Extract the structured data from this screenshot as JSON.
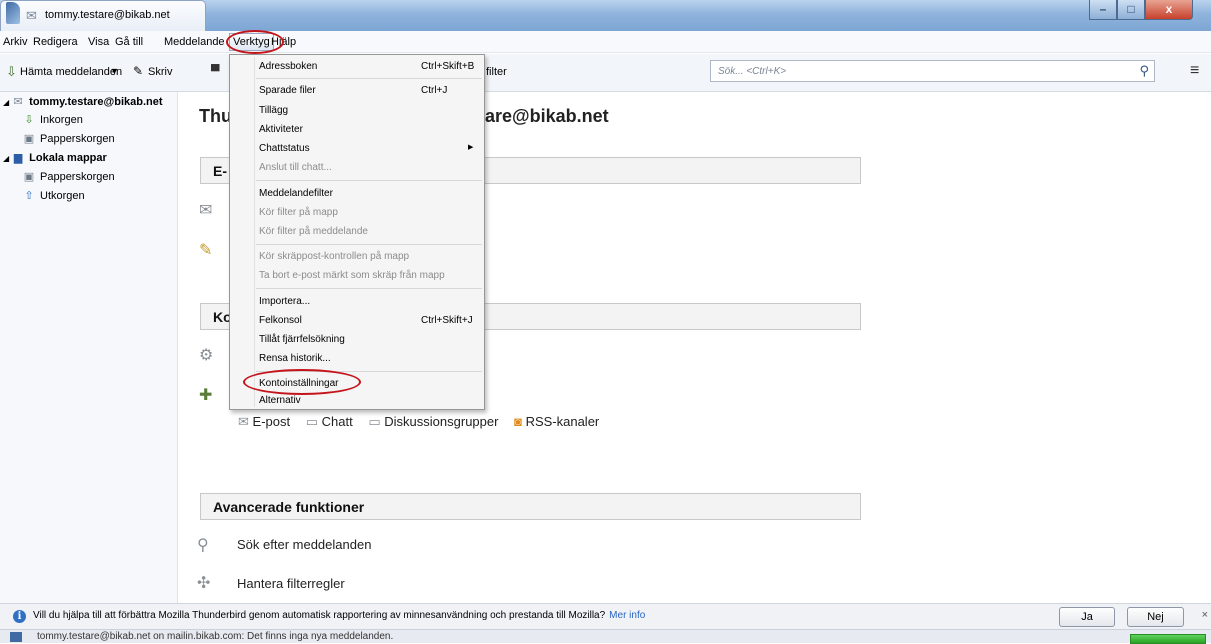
{
  "window": {
    "tab_title": "tommy.testare@bikab.net"
  },
  "menubar": {
    "items": [
      "Arkiv",
      "Redigera",
      "Visa",
      "Gå till",
      "Meddelande",
      "Verktyg",
      "Hjälp"
    ],
    "active": "Verktyg"
  },
  "toolbar": {
    "get_messages": "Hämta meddelanden",
    "write": "Skriv",
    "filter_suffix": "filter",
    "search_placeholder": "Sök... <Ctrl+K>"
  },
  "folders": {
    "account": "tommy.testare@bikab.net",
    "inbox": "Inkorgen",
    "trash": "Papperskorgen",
    "local": "Lokala mappar",
    "local_trash": "Papperskorgen",
    "outbox": "Utkorgen"
  },
  "main": {
    "title_left": "Thu",
    "title_right": "stare@bikab.net",
    "section1": "E-",
    "section2": "Ko",
    "account_types": [
      "E-post",
      "Chatt",
      "Diskussionsgrupper",
      "RSS-kanaler"
    ],
    "advanced_header": "Avancerade funktioner",
    "search_messages": "Sök efter meddelanden",
    "manage_filters": "Hantera filterregler"
  },
  "tools_menu": {
    "items": [
      {
        "label": "Adressboken",
        "shortcut": "Ctrl+Skift+B",
        "disabled": false
      },
      {
        "label": "Sparade filer",
        "shortcut": "Ctrl+J",
        "disabled": false
      },
      {
        "label": "Tillägg",
        "shortcut": "",
        "disabled": false
      },
      {
        "label": "Aktiviteter",
        "shortcut": "",
        "disabled": false
      },
      {
        "label": "Chattstatus",
        "shortcut": "",
        "disabled": false,
        "submenu": true
      },
      {
        "label": "Anslut till chatt...",
        "shortcut": "",
        "disabled": true
      },
      {
        "label": "Meddelandefilter",
        "shortcut": "",
        "disabled": false
      },
      {
        "label": "Kör filter på mapp",
        "shortcut": "",
        "disabled": true
      },
      {
        "label": "Kör filter på meddelande",
        "shortcut": "",
        "disabled": true
      },
      {
        "label": "Kör skräppost-kontrollen på mapp",
        "shortcut": "",
        "disabled": true
      },
      {
        "label": "Ta bort e-post märkt som skräp från mapp",
        "shortcut": "",
        "disabled": true
      },
      {
        "label": "Importera...",
        "shortcut": "",
        "disabled": false
      },
      {
        "label": "Felkonsol",
        "shortcut": "Ctrl+Skift+J",
        "disabled": false
      },
      {
        "label": "Tillåt fjärrfelsökning",
        "shortcut": "",
        "disabled": false
      },
      {
        "label": "Rensa historik...",
        "shortcut": "",
        "disabled": false
      },
      {
        "label": "Kontoinställningar",
        "shortcut": "",
        "disabled": false
      },
      {
        "label": "Alternativ",
        "shortcut": "",
        "disabled": false
      }
    ]
  },
  "infobar": {
    "text": "Vill du hjälpa till att förbättra Mozilla Thunderbird genom automatisk rapportering av minnesanvändning och prestanda till Mozilla?",
    "link": "Mer info",
    "yes": "Ja",
    "no": "Nej",
    "close": "×"
  },
  "status": {
    "text": "tommy.testare@bikab.net on mailin.bikab.com: Det finns inga nya meddelanden."
  }
}
